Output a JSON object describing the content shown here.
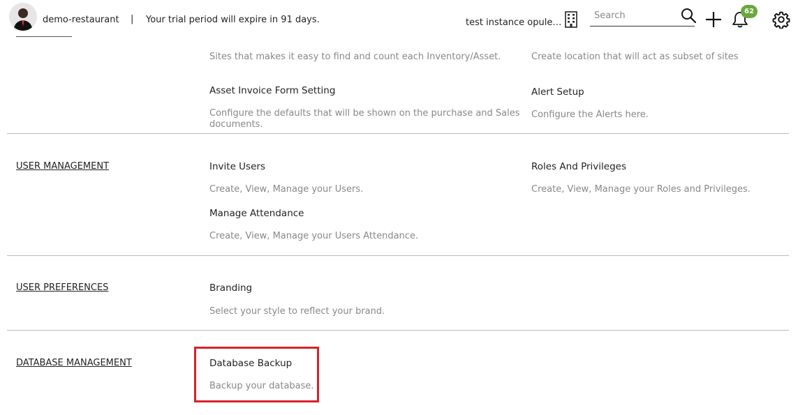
{
  "header": {
    "org_name": "demo-restaurant",
    "separator": "|",
    "trial_message": "Your trial period will expire in 91 days.",
    "instance_name": "test instance opulen...",
    "search_placeholder": "Search",
    "notification_count": "62",
    "icons": {
      "avatar": "user-avatar",
      "building": "building-icon",
      "search": "search-icon",
      "add": "plus-icon",
      "notifications": "bell-icon",
      "settings": "gear-icon"
    }
  },
  "sections": [
    {
      "title": "",
      "items": [
        {
          "title": "",
          "description": "Sites that makes it easy to find and count each Inventory/Asset."
        },
        {
          "title": "",
          "description": "Create location that will act as subset of sites"
        },
        {
          "title": "Asset Invoice Form Setting",
          "description": "Configure the defaults that will be shown on the purchase and Sales documents."
        },
        {
          "title": "Alert Setup",
          "description": "Configure the Alerts here."
        }
      ]
    },
    {
      "title": "USER MANAGEMENT",
      "items": [
        {
          "title": "Invite Users",
          "description": "Create, View, Manage your Users."
        },
        {
          "title": "Roles And Privileges",
          "description": "Create, View, Manage your Roles and Privileges."
        },
        {
          "title": "Manage Attendance",
          "description": "Create, View, Manage your Users Attendance."
        }
      ]
    },
    {
      "title": "USER PREFERENCES",
      "items": [
        {
          "title": "Branding",
          "description": "Select your style to reflect your brand."
        }
      ]
    },
    {
      "title": "DATABASE MANAGEMENT",
      "items": [
        {
          "title": "Database Backup",
          "description": "Backup your database."
        }
      ]
    }
  ],
  "colors": {
    "highlight": "#d9202a",
    "badge": "#6aa83d"
  }
}
